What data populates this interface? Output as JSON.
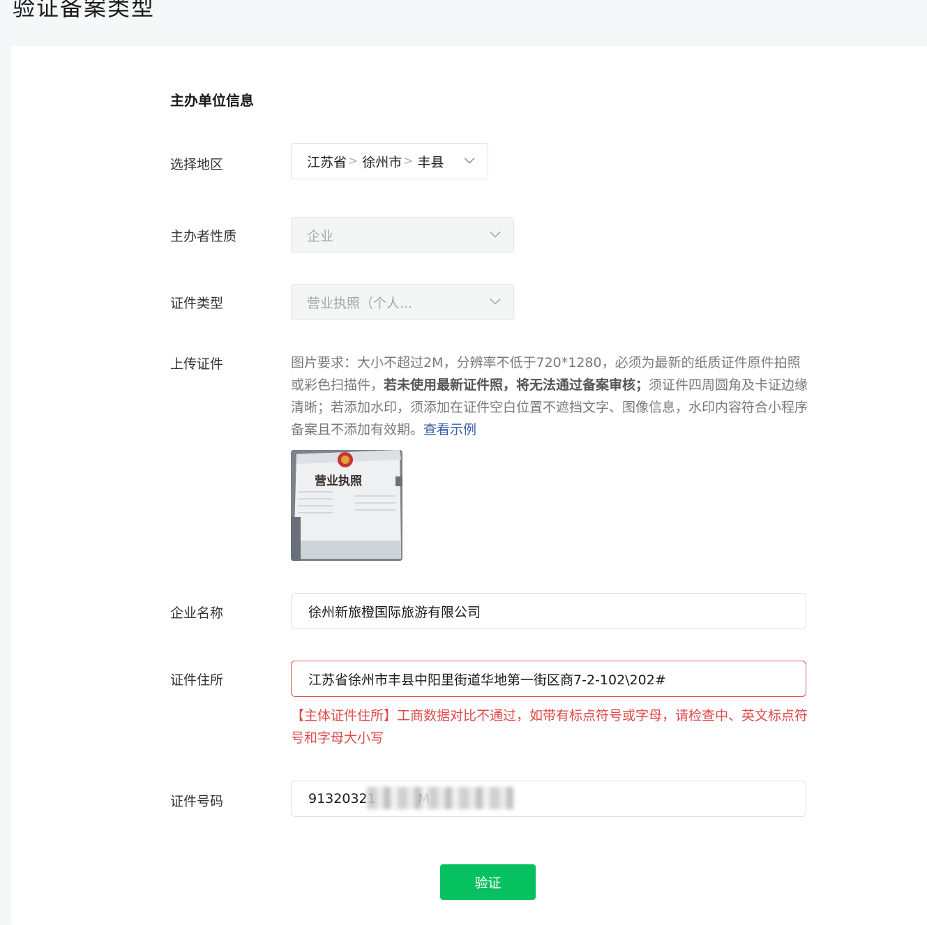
{
  "page": {
    "title": "验证备案类型"
  },
  "section": {
    "title": "主办单位信息"
  },
  "region": {
    "label": "选择地区",
    "province": "江苏省",
    "city": "徐州市",
    "county": "丰县",
    "separator": ">"
  },
  "nature": {
    "label": "主办者性质",
    "value": "企业"
  },
  "cert_type": {
    "label": "证件类型",
    "value": "营业执照（个人..."
  },
  "upload": {
    "label": "上传证件",
    "desc_part1": "图片要求：大小不超过2M，分辨率不低于720*1280，必须为最新的纸质证件原件拍照或彩色扫描件，",
    "desc_bold": "若未使用最新证件照，将无法通过备案审核；",
    "desc_part2": "须证件四周圆角及卡证边缘清晰；若添加水印，须添加在证件空白位置不遮挡文字、图像信息，水印内容符合小程序备案且不添加有效期。",
    "example_link": "查看示例",
    "thumb_title": "营业执照"
  },
  "company": {
    "label": "企业名称",
    "value": "徐州新旅橙国际旅游有限公司"
  },
  "address": {
    "label": "证件住所",
    "value": "江苏省徐州市丰县中阳里街道华地第一街区商7-2-102\\202#",
    "error": "【主体证件住所】工商数据对比不通过，如带有标点符号或字母，请检查中、英文标点符号和字母大小写"
  },
  "cert_no": {
    "label": "证件号码",
    "value": "91320321          M"
  },
  "submit": {
    "label": "验证"
  },
  "colors": {
    "primary": "#07c160",
    "error": "#e04848",
    "link": "#3a5ea8"
  }
}
